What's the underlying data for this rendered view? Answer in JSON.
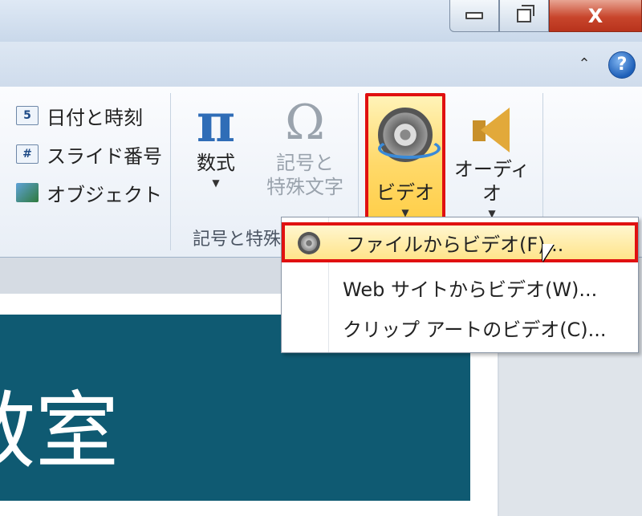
{
  "window": {
    "minimize_glyph": "",
    "maximize_glyph": "",
    "close_label": "X"
  },
  "tabstrip": {
    "minimize_ribbon_label": "⌃",
    "help_label": "?"
  },
  "ribbon": {
    "text_group": {
      "items": [
        {
          "label": "日付と時刻",
          "icon": "date-time-icon",
          "icon_text": "5"
        },
        {
          "label": "スライド番号",
          "icon": "slide-number-icon",
          "icon_text": "#"
        },
        {
          "label": "オブジェクト",
          "icon": "object-icon",
          "icon_text": ""
        }
      ]
    },
    "symbols_group": {
      "label": "記号と特殊",
      "equation": {
        "label": "数式",
        "icon_text": "π"
      },
      "symbol": {
        "label_line1": "記号と",
        "label_line2": "特殊文字",
        "icon_text": "Ω"
      }
    },
    "media_group": {
      "video": {
        "label": "ビデオ"
      },
      "audio": {
        "label": "オーディオ"
      }
    },
    "dropdown_arrow": "▼"
  },
  "video_menu": {
    "items": [
      {
        "label": "ファイルからビデオ(F)...",
        "highlighted": true
      },
      {
        "label": "Web サイトからビデオ(W)...",
        "highlighted": false
      },
      {
        "label": "クリップ アートのビデオ(C)...",
        "highlighted": false
      }
    ]
  },
  "slide": {
    "title_text": "教室",
    "banner_color": "#0f5a72"
  },
  "colors": {
    "highlight_border": "#e01010",
    "ribbon_accent": "#2f6db7"
  }
}
